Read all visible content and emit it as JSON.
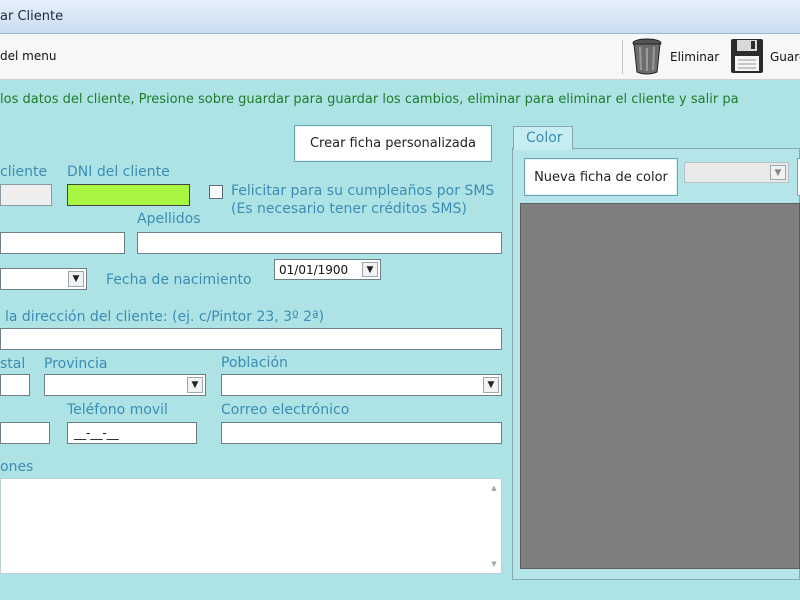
{
  "window": {
    "title": "ar Cliente"
  },
  "toolbar": {
    "back_label": "del menu",
    "delete_label": "Eliminar",
    "save_label": "Guarda"
  },
  "info_text": "los datos del cliente, Presione sobre guardar para guardar los cambios, eliminar para eliminar el cliente y salir pa",
  "form": {
    "custom_sheet_button": "Crear ficha personalizada",
    "client_code_label": "cliente",
    "dni_label": "DNI del cliente",
    "sms_checkbox_label_1": "Felicitar para su cumpleaños por SMS",
    "sms_checkbox_label_2": "(Es necesario tener créditos SMS)",
    "surname_label": "Apellidos",
    "birthdate_label": "Fecha de nacimiento",
    "birthdate_value": "01/01/1900",
    "address_label": "la dirección del cliente: (ej. c/Pintor 23, 3º 2ª)",
    "postal_label": "stal",
    "province_label": "Provincia",
    "town_label": "Población",
    "mobile_label": "Teléfono movil",
    "mobile_value": "__-__-__",
    "email_label": "Correo electrónico",
    "notes_label": "ones"
  },
  "color_panel": {
    "tab_label": "Color",
    "new_color_button": "Nueva ficha de color",
    "swatch_color": "#7f7f7f"
  },
  "colors": {
    "background": "#aee3e6",
    "label": "#3b8db4",
    "info": "#1d7d2a",
    "dni_field": "#a8f542"
  }
}
